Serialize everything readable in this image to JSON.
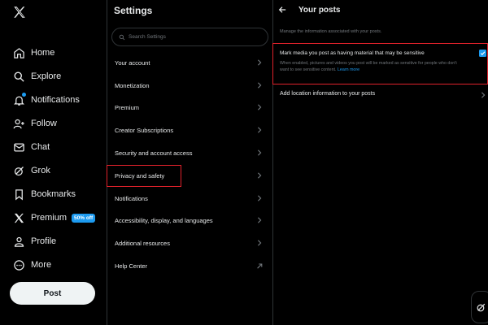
{
  "nav": {
    "items": [
      {
        "label": "Home",
        "icon": "home-icon"
      },
      {
        "label": "Explore",
        "icon": "search-icon"
      },
      {
        "label": "Notifications",
        "icon": "bell-icon"
      },
      {
        "label": "Follow",
        "icon": "follow-icon"
      },
      {
        "label": "Chat",
        "icon": "mail-icon"
      },
      {
        "label": "Grok",
        "icon": "grok-icon"
      },
      {
        "label": "Bookmarks",
        "icon": "bookmark-icon"
      },
      {
        "label": "Premium",
        "icon": "x-logo-icon",
        "badge": "50% off"
      },
      {
        "label": "Profile",
        "icon": "person-icon"
      },
      {
        "label": "More",
        "icon": "more-icon"
      }
    ],
    "post_label": "Post"
  },
  "settings": {
    "title": "Settings",
    "search_placeholder": "Search Settings",
    "items": [
      {
        "label": "Your account"
      },
      {
        "label": "Monetization"
      },
      {
        "label": "Premium"
      },
      {
        "label": "Creator Subscriptions"
      },
      {
        "label": "Security and account access"
      },
      {
        "label": "Privacy and safety",
        "highlighted": true
      },
      {
        "label": "Notifications"
      },
      {
        "label": "Accessibility, display, and languages"
      },
      {
        "label": "Additional resources"
      },
      {
        "label": "Help Center",
        "external": true
      }
    ]
  },
  "pane": {
    "title": "Your posts",
    "description": "Manage the information associated with your posts.",
    "sensitive": {
      "title": "Mark media you post as having material that may be sensitive",
      "desc_1": "When enabled, pictures and videos you post will be marked as sensitive for people who don't",
      "desc_2": "want to see sensitive content.",
      "learn_more": "Learn more",
      "checked": true
    },
    "location_label": "Add location information to your posts"
  },
  "colors": {
    "accent": "#1d9bf0",
    "highlight": "#e0212b",
    "background": "#000000",
    "text": "#e7e9ea",
    "muted": "#71767b"
  }
}
